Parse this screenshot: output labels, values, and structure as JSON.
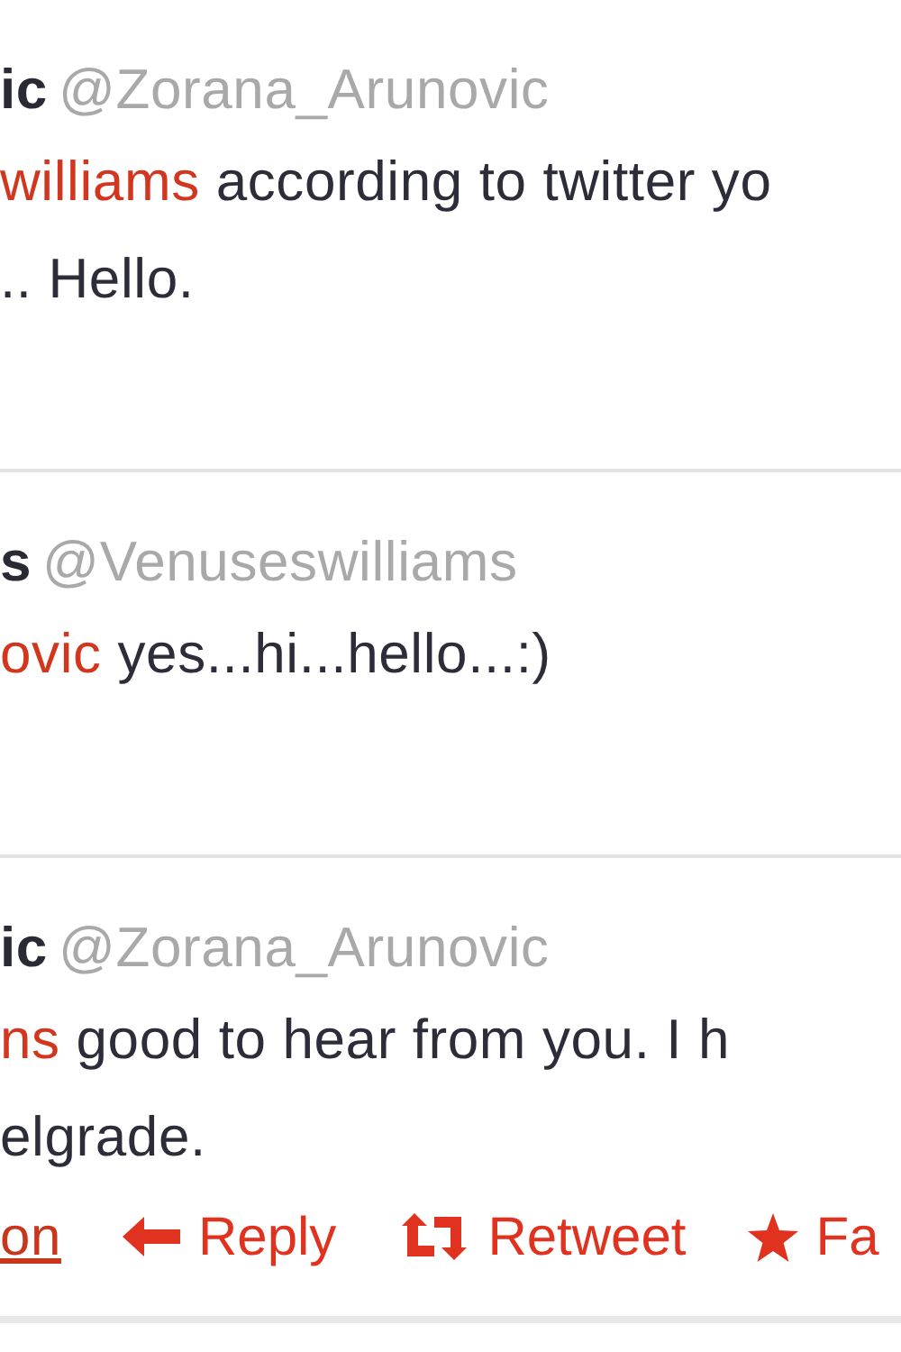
{
  "tweets": [
    {
      "name": "ic",
      "handle": "@Zorana_Arunovic",
      "lines": [
        {
          "mention": "williams",
          "text": " according to twitter yo"
        },
        {
          "text": ".. Hello."
        }
      ]
    },
    {
      "name": "s",
      "handle": "@Venuseswilliams",
      "lines": [
        {
          "mention": "ovic",
          "text": " yes...hi...hello...:)"
        }
      ]
    },
    {
      "name": "ic",
      "handle": "@Zorana_Arunovic",
      "lines": [
        {
          "mention": "ns",
          "text": " good to hear from you. I h"
        },
        {
          "text": "elgrade."
        }
      ],
      "actions": [
        {
          "kind": "link",
          "label": "on"
        },
        {
          "kind": "reply",
          "label": "Reply"
        },
        {
          "kind": "retweet",
          "label": "Retweet"
        },
        {
          "kind": "favorite",
          "label": "Fa"
        }
      ]
    }
  ]
}
